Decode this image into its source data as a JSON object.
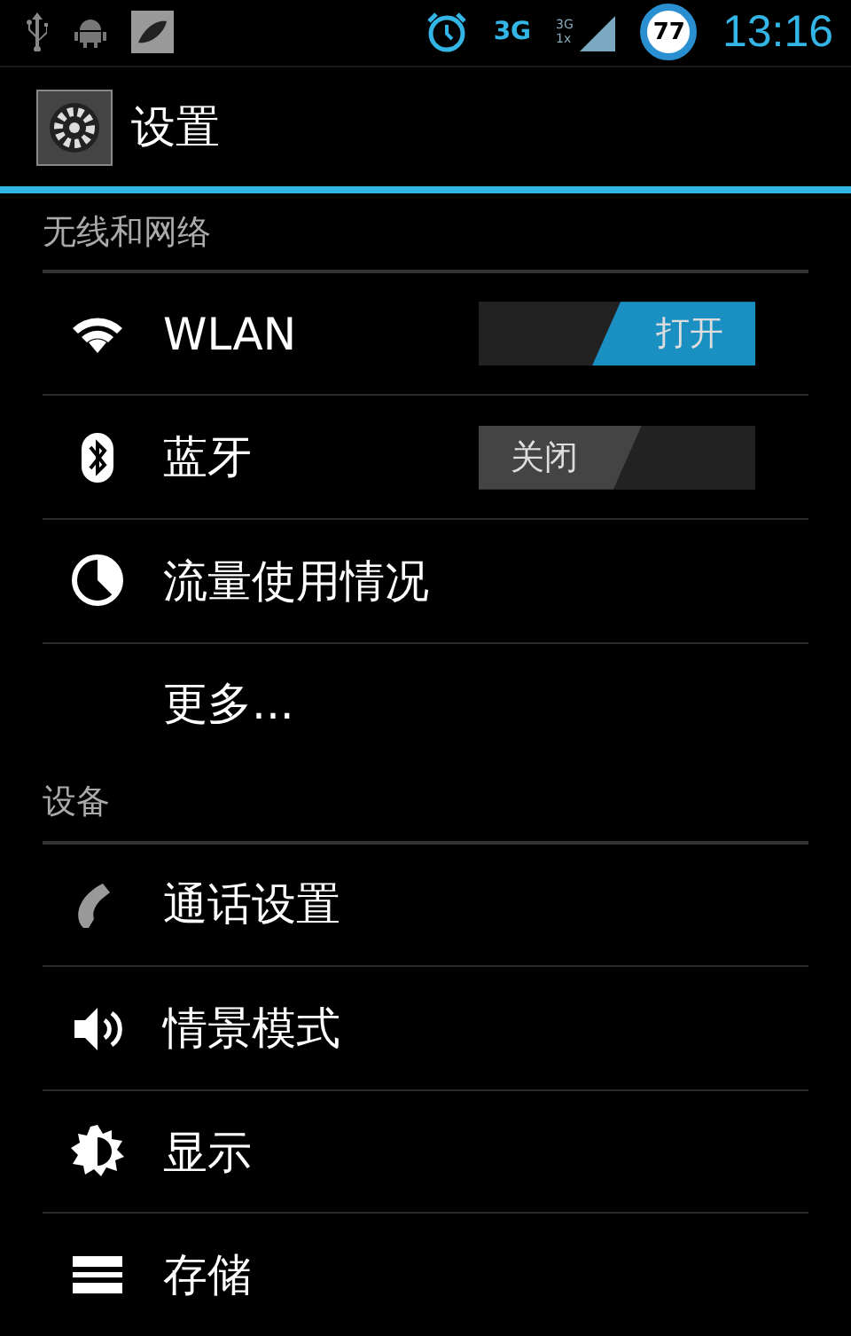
{
  "status_bar": {
    "network_small": [
      "3G",
      "1x"
    ],
    "network_type": "3G",
    "battery": "77",
    "time": "13:16"
  },
  "action_bar": {
    "title": "设置"
  },
  "sections": [
    {
      "header": "无线和网络",
      "items": [
        {
          "kind": "toggle",
          "label": "WLAN",
          "on": true,
          "switch_text": "打开"
        },
        {
          "kind": "toggle",
          "label": "蓝牙",
          "on": false,
          "switch_text": "关闭"
        },
        {
          "kind": "plain",
          "label": "流量使用情况"
        },
        {
          "kind": "plain",
          "label": "更多..."
        }
      ]
    },
    {
      "header": "设备",
      "items": [
        {
          "kind": "plain",
          "label": "通话设置"
        },
        {
          "kind": "plain",
          "label": "情景模式"
        },
        {
          "kind": "plain",
          "label": "显示"
        },
        {
          "kind": "plain",
          "label": "存储"
        }
      ]
    }
  ]
}
